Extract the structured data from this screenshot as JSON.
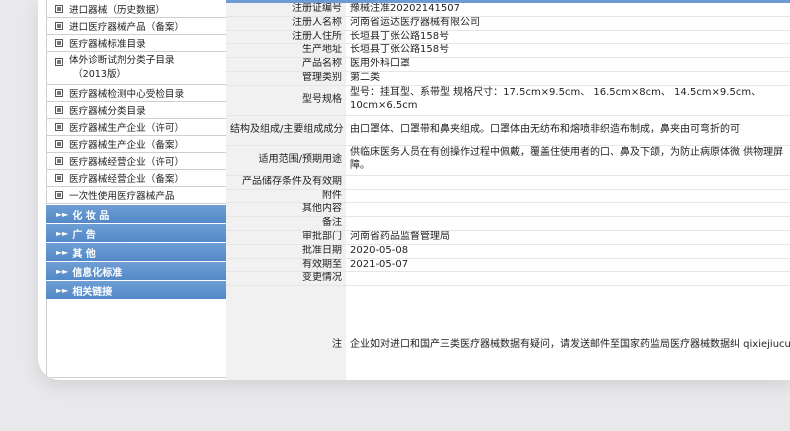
{
  "sidebar": {
    "items": [
      "进口器械（历史数据）",
      "进口医疗器械产品（备案）",
      "医疗器械标准目录",
      [
        "体外诊断试剂分类子目录",
        "（2013版）"
      ],
      "医疗器械检测中心受检目录",
      "医疗器械分类目录",
      "医疗器械生产企业（许可）",
      "医疗器械生产企业（备案）",
      "医疗器械经营企业（许可）",
      "医疗器械经营企业（备案）",
      "一次性使用医疗器械产品"
    ],
    "categories": [
      "化 妆 品",
      "广    告",
      "其    他",
      "信息化标准",
      "相关链接"
    ]
  },
  "detail": {
    "rows": [
      {
        "key": "注册证编号",
        "value": "豫械注准20202141507"
      },
      {
        "key": "注册人名称",
        "value": "河南省运达医疗器械有限公司"
      },
      {
        "key": "注册人住所",
        "value": "长垣县丁张公路158号"
      },
      {
        "key": "生产地址",
        "value": "长垣县丁张公路158号"
      },
      {
        "key": "产品名称",
        "value": "医用外科口罩"
      },
      {
        "key": "管理类别",
        "value": "第二类"
      },
      {
        "key": "型号规格",
        "value": "型号：挂耳型、系带型 规格尺寸：17.5cm×9.5cm、 16.5cm×8cm、 14.5cm×9.5cm、 10cm×6.5cm"
      },
      {
        "key": "结构及组成/主要组成成分",
        "value": "由口罩体、口罩带和鼻夹组成。口罩体由无纺布和熔喷非织造布制成，鼻夹由可弯折的可"
      },
      {
        "key": "适用范围/预期用途",
        "value": "供临床医务人员在有创操作过程中佩戴，覆盖住使用者的口、鼻及下颌，为防止病原体微 供物理屏障。"
      },
      {
        "key": "产品储存条件及有效期",
        "value": ""
      },
      {
        "key": "附件",
        "value": ""
      },
      {
        "key": "其他内容",
        "value": ""
      },
      {
        "key": "备注",
        "value": ""
      },
      {
        "key": "审批部门",
        "value": "河南省药品监督管理局"
      },
      {
        "key": "批准日期",
        "value": "2020-05-08"
      },
      {
        "key": "有效期至",
        "value": "2021-05-07"
      },
      {
        "key": "变更情况",
        "value": ""
      }
    ],
    "remark_key": "注",
    "remark_text": "企业如对进口和国产三类医疗器械数据有疑问，请发送邮件至国家药监局医疗器械数据纠 qixiejiucuo@nmpaic.org.cn【邮件主题请注明“医疗器械数据问题”，邮件正文中请准 册证号/备案号；2.类型（注册、变更、延续等）；3.问题描述（500字以内）；4.企业名 6.联系人姓名；7.联系电话（手机和座机）；8.联系邮箱】，或致电国家药监局医疗器械数 为我局医疗器械数据纠错联系电话，并非相应产品/企业业务咨询电话）。企业如对国产二 询国家局信息中心，电话010-88331520（工作日）。也可通过发邮件与我们联系：邮"
  }
}
